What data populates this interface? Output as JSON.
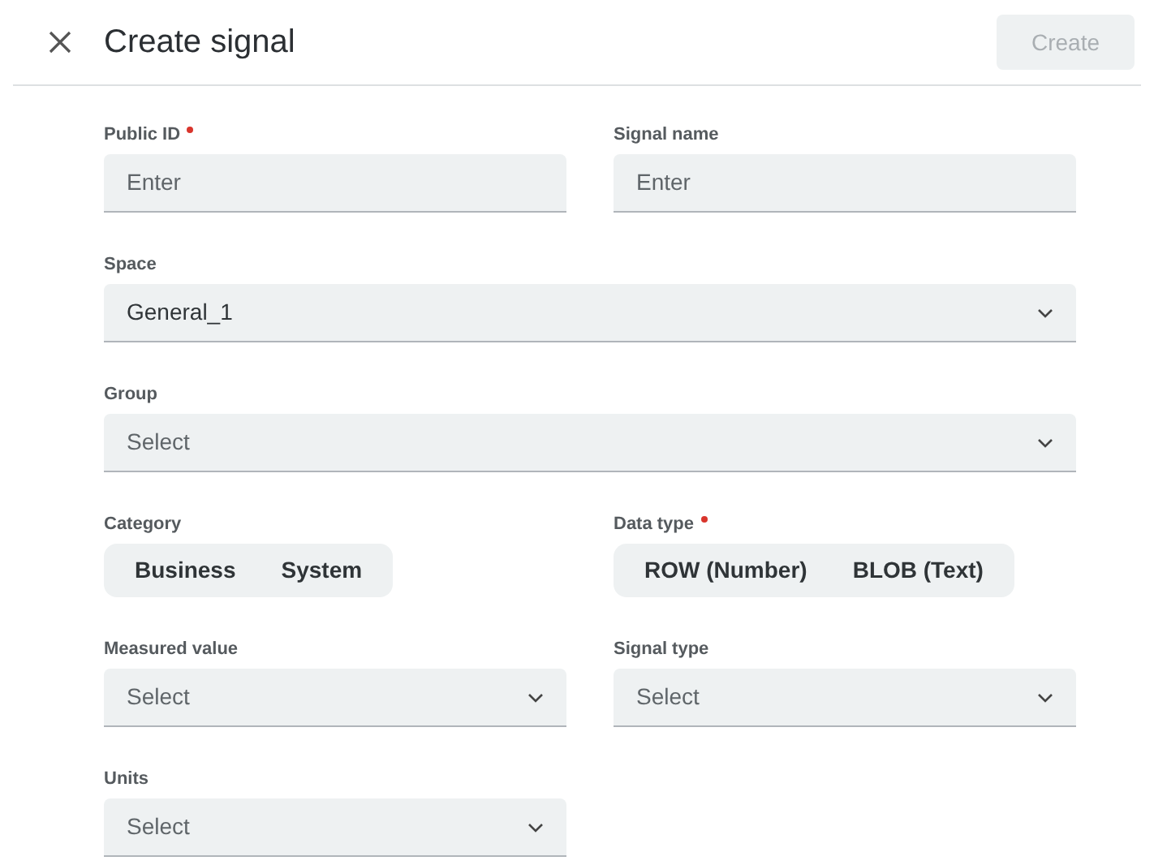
{
  "header": {
    "title": "Create signal",
    "create_button": {
      "label": "Create",
      "disabled": true
    }
  },
  "rows": [
    {
      "fields": [
        {
          "kind": "input",
          "wide": false,
          "label": "Public ID",
          "required": true,
          "placeholder": "Enter"
        },
        {
          "kind": "input",
          "wide": false,
          "label": "Signal name",
          "required": false,
          "placeholder": "Enter"
        }
      ]
    },
    {
      "fields": [
        {
          "kind": "select",
          "wide": true,
          "label": "Space",
          "required": false,
          "value": "General_1"
        }
      ]
    },
    {
      "fields": [
        {
          "kind": "select",
          "wide": true,
          "label": "Group",
          "required": false,
          "placeholder": "Select"
        }
      ]
    },
    {
      "fields": [
        {
          "kind": "segmented",
          "wide": false,
          "label": "Category",
          "required": false,
          "options": [
            "Business",
            "System"
          ]
        },
        {
          "kind": "segmented",
          "wide": false,
          "label": "Data type",
          "required": true,
          "options": [
            "ROW (Number)",
            "BLOB (Text)"
          ]
        }
      ]
    },
    {
      "fields": [
        {
          "kind": "select",
          "wide": false,
          "label": "Measured value",
          "required": false,
          "placeholder": "Select"
        },
        {
          "kind": "select",
          "wide": false,
          "label": "Signal type",
          "required": false,
          "placeholder": "Select"
        }
      ]
    },
    {
      "fields": [
        {
          "kind": "select",
          "wide": false,
          "label": "Units",
          "required": false,
          "placeholder": "Select"
        }
      ]
    }
  ]
}
